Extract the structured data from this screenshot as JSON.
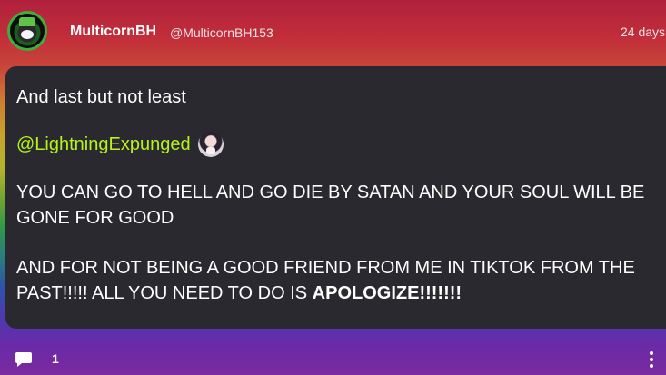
{
  "post": {
    "author": {
      "name": "MulticornBH",
      "handle": "@MulticornBH153",
      "avatar_icon": "avatar"
    },
    "time": "24 days",
    "body": {
      "line1": "And last but not least",
      "mention": "@LightningExpunged",
      "line3": "YOU CAN GO TO HELL AND GO DIE BY SATAN AND YOUR SOUL WILL BE GONE FOR GOOD",
      "line4_prefix": "AND FOR NOT BEING A GOOD FRIEND FROM ME IN TIKTOK FROM THE PAST!!!!! ALL YOU NEED TO DO IS ",
      "line4_bold": "APOLOGIZE!!!!!!!"
    },
    "comments": {
      "count": "1",
      "icon": "comment-icon"
    },
    "more_icon": "more-vertical-icon"
  },
  "colors": {
    "card_bg": "#2a292f",
    "mention": "#b7f21b",
    "text": "#ffffff"
  }
}
